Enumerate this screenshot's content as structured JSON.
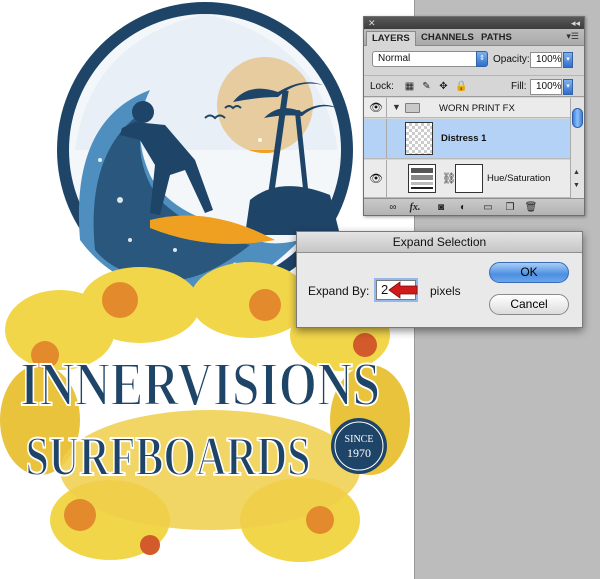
{
  "layers_panel": {
    "tabs": [
      "LAYERS",
      "CHANNELS",
      "PATHS"
    ],
    "blend_mode": "Normal",
    "opacity_label": "Opacity:",
    "opacity_value": "100%",
    "lock_label": "Lock:",
    "fill_label": "Fill:",
    "fill_value": "100%",
    "layers": [
      {
        "name": "WORN PRINT FX",
        "kind": "group",
        "visible": true
      },
      {
        "name": "Distress 1",
        "kind": "layer",
        "visible": true,
        "selected": true
      },
      {
        "name": "Hue/Saturation",
        "kind": "adjustment",
        "visible": true
      }
    ],
    "icons": [
      "close-icon",
      "collapse-icon",
      "panel-menu-icon",
      "eye-icon",
      "folder-icon",
      "chain-icon",
      "link-layers-icon",
      "fx-icon",
      "add-mask-icon",
      "adjustment-layer-icon",
      "new-group-icon",
      "new-layer-icon",
      "trash-icon"
    ]
  },
  "dialog": {
    "title": "Expand Selection",
    "expand_label": "Expand By:",
    "expand_value": "2",
    "unit_label": "pixels",
    "ok_label": "OK",
    "cancel_label": "Cancel",
    "annotation_arrow_color": "#d11a1a"
  },
  "artwork": {
    "headline": "INNERVISIONS",
    "subhead": "SURFBOARDS",
    "seal_top": "SINCE",
    "seal_year": "1970",
    "colors": {
      "navy": "#1e4468",
      "sun": "#f0a020",
      "hibiscus_yellow": "#f2d64a",
      "hibiscus_orange": "#e38a2c",
      "wave_blue": "#4f8fbf"
    }
  }
}
